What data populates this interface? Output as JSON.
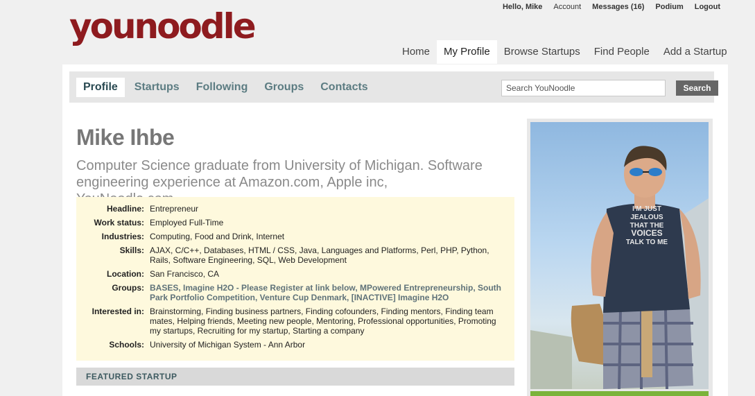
{
  "logo": "younoodle",
  "topnav": {
    "greeting": "Hello, Mike",
    "links": [
      "Account",
      "Messages (16)",
      "Podium",
      "Logout"
    ]
  },
  "mainnav": [
    "Home",
    "My Profile",
    "Browse Startups",
    "Find People",
    "Add a Startup"
  ],
  "subnav": {
    "tabs": [
      "Profile",
      "Startups",
      "Following",
      "Groups",
      "Contacts"
    ],
    "search_placeholder": "Search YouNoodle",
    "search_button": "Search"
  },
  "profile": {
    "name": "Mike Ihbe",
    "summary": "Computer Science graduate from University of Michigan. Software engineering experience at Amazon.com, Apple inc, YouNoodle.com.",
    "details": [
      {
        "label": "Headline:",
        "value": "Entrepreneur"
      },
      {
        "label": "Work status:",
        "value": "Employed Full-Time"
      },
      {
        "label": "Industries:",
        "value": "Computing, Food and Drink, Internet"
      },
      {
        "label": "Skills:",
        "value": "AJAX, C/C++, Databases, HTML / CSS, Java, Languages and Platforms, Perl, PHP, Python, Rails, Software Engineering, SQL, Web Development"
      },
      {
        "label": "Location:",
        "value": "San Francisco, CA"
      },
      {
        "label": "Groups:",
        "value": "BASES, Imagine H2O - Please Register at link below, MPowered Entrepreneurship, South Park Portfolio Competition, Venture Cup Denmark, [INACTIVE] Imagine H2O"
      },
      {
        "label": "Interested in:",
        "value": "Brainstorming, Finding business partners, Finding cofounders, Finding mentors, Finding team mates, Helping friends, Meeting new people, Mentoring, Professional opportunities, Promoting my startups, Recruiting for my startup, Starting a company"
      },
      {
        "label": "Schools:",
        "value": "University of Michigan System - Ann Arbor"
      }
    ],
    "featured_heading": "FEATURED STARTUP",
    "shirt_text": [
      "I'M JUST",
      "JEALOUS",
      "THAT THE",
      "VOICES",
      "TALK TO ME"
    ]
  },
  "colors": {
    "logo": "#8e1b1f",
    "tab_text": "#5c7c82",
    "details_bg": "#fef9dd",
    "green_bar": "#7bb33a"
  }
}
